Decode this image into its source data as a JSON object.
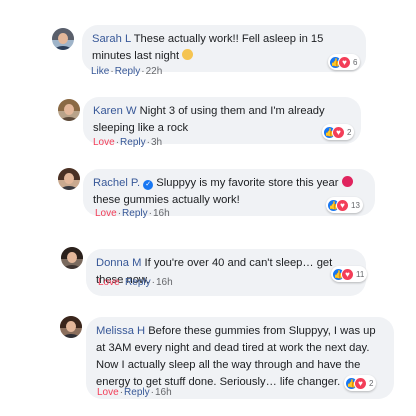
{
  "comments": [
    {
      "name": "Sarah L",
      "text": "These actually work!! Fell asleep in 15 minutes last night",
      "emoji": "face-with-hearts",
      "reaction_count": "6",
      "action": "Like",
      "reply": "Reply",
      "time": "22h"
    },
    {
      "name": "Karen W",
      "text": "Night 3 of using them and I'm already sleeping like a rock",
      "reaction_count": "2",
      "action": "Love",
      "reply": "Reply",
      "time": "3h"
    },
    {
      "name": "Rachel P.",
      "text_before": "Sluppyy is my favorite store this year",
      "text_after": "these gummies actually work!",
      "emoji": "heart-eyes",
      "verified": true,
      "reaction_count": "13",
      "action": "Love",
      "reply": "Reply",
      "time": "16h"
    },
    {
      "name": "Donna M",
      "text": "If you're over 40 and can't sleep… get these now.",
      "reaction_count": "11",
      "action": "Love",
      "reply": "Reply",
      "time": "16h"
    },
    {
      "name": "Melissa H",
      "text": "Before these gummies from Sluppyy, I was up at 3AM every night and dead tired at work the next day. Now I actually sleep all the way through and have the energy to get stuff done. Seriously… life changer.",
      "reaction_count": "2",
      "action": "Love",
      "reply": "Reply",
      "time": "16h"
    }
  ],
  "colors": {
    "bubble": "#f0f2f5",
    "name": "#385898",
    "love": "#f33e58",
    "like": "#1877f2",
    "meta": "#65676b"
  }
}
